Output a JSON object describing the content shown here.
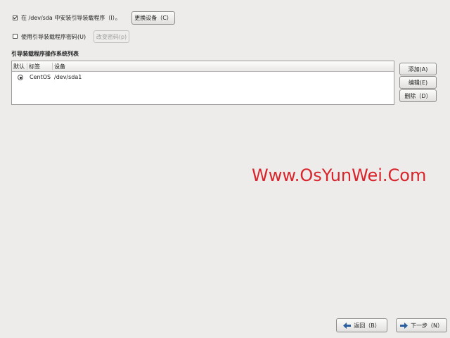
{
  "install_bootloader": {
    "checked": true,
    "label": "在 /dev/sda 中安装引导装载程序（I）。",
    "change_device_button": "更换设备（C）"
  },
  "bootloader_password": {
    "checked": false,
    "label": "使用引导装载程序密码(U)",
    "change_password_button": "改变密码(p)"
  },
  "os_list": {
    "title": "引导装载程序操作系统列表",
    "columns": [
      "默认",
      "标签",
      "设备"
    ],
    "rows": [
      {
        "default": true,
        "label": "CentOS",
        "device": "/dev/sda1"
      }
    ]
  },
  "side_buttons": {
    "add": "添加(A)",
    "edit": "编辑(E)",
    "delete": "删除（D）"
  },
  "watermark": "Www.OsYunWei.Com",
  "nav": {
    "back": "返回（B）",
    "next": "下一步（N）"
  },
  "colors": {
    "background": "#edeceb",
    "watermark": "#d8242a",
    "nav_icon": "#2c5fa0"
  }
}
